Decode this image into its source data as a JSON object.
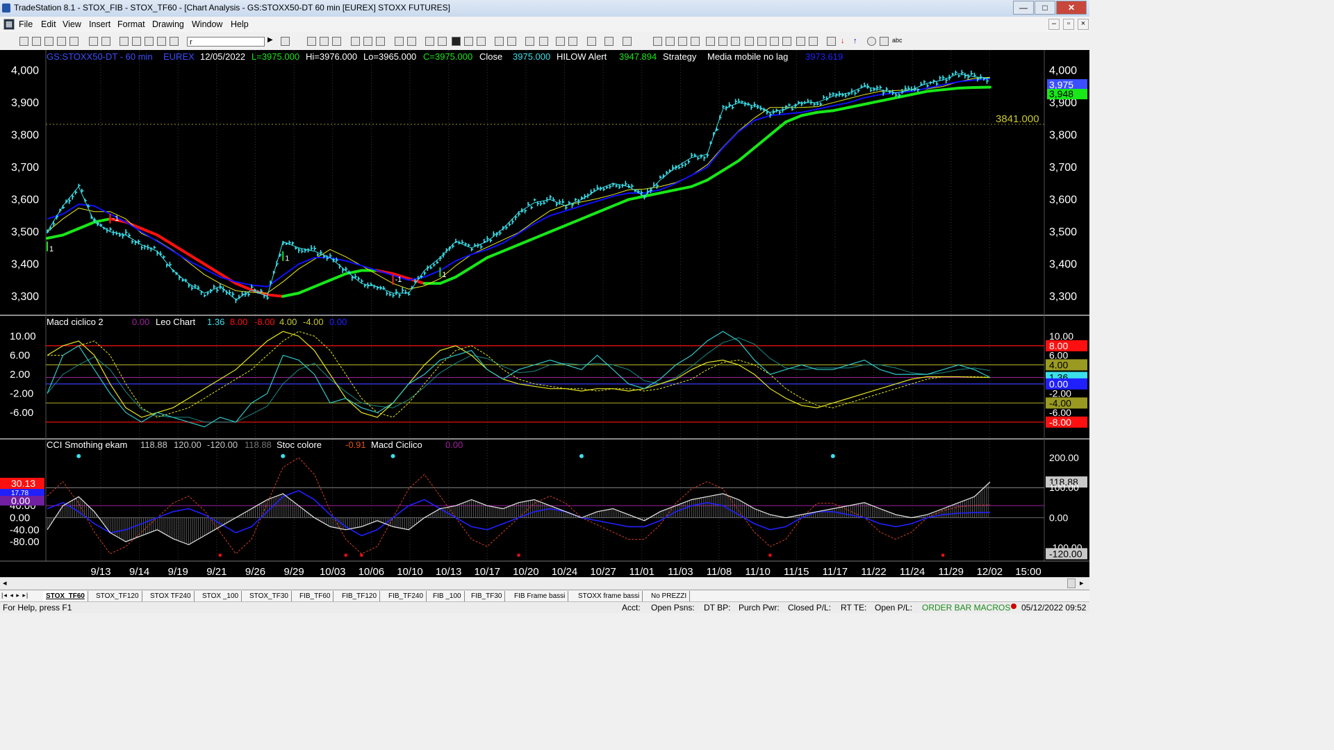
{
  "window": {
    "title": "TradeStation 8.1 - STOX_FIB - STOX_TF60 - [Chart Analysis - GS:STOXX50-DT  60 min  [EUREX] STOXX FUTURES]"
  },
  "menu": [
    "File",
    "Edit",
    "View",
    "Insert",
    "Format",
    "Drawing",
    "Window",
    "Help"
  ],
  "toolbar": {
    "symbol_value": "r"
  },
  "header": {
    "symbol": "GS:STOXX50-DT - 60 min",
    "exchange": "EUREX",
    "date": "12/05/2022",
    "last": "L=3975.000",
    "high": "Hi=3976.000",
    "low": "Lo=3965.000",
    "close": "C=3975.000",
    "close_label": "Close",
    "close_value": "3975.000",
    "hilow_label": "HILOW Alert",
    "hilow_value": "3947.894",
    "strategy_label": "Strategy",
    "media_label": "Media mobile no lag",
    "media_value": "3973.619"
  },
  "macd_header": {
    "name": "Macd ciclico 2",
    "v1": "0.00",
    "leo": "Leo Chart",
    "v2": "1.36",
    "v3": "8.00",
    "v4": "-8.00",
    "v5": "4.00",
    "v6": "-4.00",
    "v7": "0.00"
  },
  "cci_header": {
    "name": "CCI Smothing ekam",
    "v1": "118.88",
    "v2": "120.00",
    "v3": "-120.00",
    "v4": "118.88",
    "stoc": "Stoc colore",
    "stoc_val": "-0.91",
    "macd": "Macd Ciclico",
    "macd_val": "0.00"
  },
  "colors": {
    "price": "#3be0ea",
    "blue": "#1010ff",
    "green": "#18e818",
    "red": "#ff1010",
    "yellow": "#e8e820",
    "bg": "#000000"
  },
  "price_axis": {
    "ticks": [
      "4,000",
      "3,900",
      "3,800",
      "3,700",
      "3,600",
      "3,500",
      "3,400",
      "3,300"
    ]
  },
  "price_right_labels": {
    "last": "3,975",
    "hilow": "3,948",
    "line_value": "3841.000"
  },
  "macd_axis": {
    "ticks": [
      "10.00",
      "6.00",
      "2.00",
      "-2.00",
      "-6.00"
    ]
  },
  "macd_right_labels": {
    "red_top": "8.00",
    "tick6": "6.00",
    "yellow_top": "4.00",
    "current": "1.36",
    "zero": "0.00",
    "tick_m2": "-2.00",
    "yellow_bot": "-4.00",
    "tick_m6": "-6.00",
    "red_bot": "-8.00"
  },
  "cci_axis": {
    "ticks": [
      "80.00",
      "40.00",
      "0.00",
      "-40.00",
      "-80.00"
    ]
  },
  "cci_left_labels": {
    "red": "30.13",
    "blue": "17.78",
    "purple": "0.00"
  },
  "cci_right_labels": {
    "top": "200.00",
    "current": "118.88",
    "mid": "100.00",
    "zero": "0.00",
    "low": "-100.00",
    "bottom": "-120.00"
  },
  "date_axis": [
    "9/13",
    "9/14",
    "9/19",
    "9/21",
    "9/26",
    "9/29",
    "10/03",
    "10/06",
    "10/10",
    "10/13",
    "10/17",
    "10/20",
    "10/24",
    "10/27",
    "11/01",
    "11/03",
    "11/08",
    "11/10",
    "11/15",
    "11/17",
    "11/22",
    "11/24",
    "11/29",
    "12/02",
    "15:00"
  ],
  "signals": [
    "1",
    "-1",
    "1",
    "-1",
    "1"
  ],
  "tabs": [
    "STOX_TF60",
    "STOX_TF120",
    "STOX TF240",
    "STOX _100",
    "STOX_TF30",
    "FIB_TF60",
    "FIB_TF120",
    "FIB_TF240",
    "FIB _100",
    "FIB_TF30",
    "FIB Frame bassi",
    "STOXX frame bassi",
    "No PREZZI"
  ],
  "status": {
    "help": "For Help, press F1",
    "acct": "Acct:",
    "open_psns": "Open Psns:",
    "dt_bp": "DT BP:",
    "purch_pwr": "Purch Pwr:",
    "closed_pl": "Closed P/L:",
    "rt_te": "RT TE:",
    "open_pl": "Open P/L:",
    "macros": "ORDER BAR  MACROS",
    "datetime": "05/12/2022 09:52"
  },
  "chart_data": [
    {
      "type": "line",
      "title": "GS:STOXX50-DT - 60 min",
      "x": [
        "9/12",
        "9/13",
        "9/14",
        "9/15",
        "9/16",
        "9/19",
        "9/20",
        "9/21",
        "9/22",
        "9/23",
        "9/26",
        "9/27",
        "9/28",
        "9/29",
        "9/30",
        "10/03",
        "10/04",
        "10/05",
        "10/06",
        "10/07",
        "10/10",
        "10/11",
        "10/12",
        "10/13",
        "10/14",
        "10/17",
        "10/18",
        "10/19",
        "10/20",
        "10/21",
        "10/24",
        "10/25",
        "10/26",
        "10/27",
        "10/28",
        "10/31",
        "11/01",
        "11/02",
        "11/03",
        "11/04",
        "11/07",
        "11/08",
        "11/09",
        "11/10",
        "11/11",
        "11/14",
        "11/15",
        "11/16",
        "11/17",
        "11/18",
        "11/21",
        "11/22",
        "11/23",
        "11/24",
        "11/25",
        "11/28",
        "11/29",
        "11/30",
        "12/01",
        "12/02",
        "12/05"
      ],
      "series": [
        {
          "values": [
            3500,
            3580,
            3640,
            3530,
            3500,
            3490,
            3460,
            3440,
            3380,
            3340,
            3310,
            3330,
            3290,
            3320,
            3300,
            3470,
            3450,
            3440,
            3420,
            3380,
            3340,
            3330,
            3310,
            3310,
            3380,
            3420,
            3470,
            3450,
            3470,
            3510,
            3560,
            3590,
            3600,
            3580,
            3600,
            3630,
            3650,
            3640,
            3610,
            3660,
            3700,
            3730,
            3740,
            3880,
            3900,
            3890,
            3870,
            3880,
            3900,
            3900,
            3920,
            3930,
            3950,
            3940,
            3930,
            3940,
            3960,
            3970,
            3990,
            3980,
            3975
          ]
        },
        {
          "values": [
            3540,
            3555,
            3585,
            3580,
            3555,
            3530,
            3500,
            3470,
            3440,
            3410,
            3385,
            3360,
            3345,
            3335,
            3330,
            3365,
            3400,
            3420,
            3420,
            3410,
            3395,
            3380,
            3365,
            3350,
            3360,
            3380,
            3410,
            3430,
            3445,
            3465,
            3495,
            3525,
            3550,
            3565,
            3580,
            3595,
            3610,
            3620,
            3620,
            3630,
            3650,
            3675,
            3700,
            3760,
            3810,
            3845,
            3860,
            3865,
            3870,
            3880,
            3890,
            3900,
            3915,
            3925,
            3930,
            3935,
            3945,
            3955,
            3965,
            3970,
            3974
          ]
        },
        {
          "values": [
            3480,
            3490,
            3510,
            3530,
            3540,
            3530,
            3510,
            3490,
            3460,
            3430,
            3400,
            3370,
            3340,
            3320,
            3305,
            3300,
            3310,
            3330,
            3350,
            3370,
            3380,
            3380,
            3370,
            3355,
            3340,
            3340,
            3360,
            3390,
            3420,
            3440,
            3460,
            3480,
            3500,
            3520,
            3540,
            3560,
            3580,
            3600,
            3610,
            3620,
            3630,
            3640,
            3660,
            3690,
            3720,
            3760,
            3800,
            3840,
            3860,
            3870,
            3875,
            3885,
            3895,
            3905,
            3915,
            3925,
            3935,
            3940,
            3945,
            3947,
            3948
          ]
        }
      ],
      "ylim": [
        3250,
        4020
      ],
      "price_line": 3841
    },
    {
      "type": "line",
      "title": "Macd ciclico 2",
      "ylim": [
        -10.5,
        12.2
      ],
      "levels": [
        8,
        4,
        0,
        -4,
        -8
      ],
      "series": [
        {
          "values": [
            -2,
            6,
            8,
            3,
            -2,
            -6,
            -8,
            -6,
            -7,
            -8,
            -9,
            -7,
            -8,
            -4,
            -2,
            6,
            5,
            2,
            -4,
            -3,
            -5,
            -6,
            -4,
            0,
            2,
            5,
            6,
            7,
            3,
            1,
            3,
            4,
            5,
            4,
            3,
            6,
            3,
            0,
            -1,
            1,
            4,
            6,
            9,
            11,
            9,
            5,
            2,
            3,
            4,
            3,
            3,
            4,
            5,
            3,
            2,
            2,
            2,
            3,
            4,
            3,
            1.36
          ]
        },
        {
          "values": [
            6,
            8,
            9,
            6,
            0,
            -5,
            -7,
            -6,
            -5,
            -3,
            -1,
            1,
            3,
            6,
            9,
            11,
            10,
            7,
            2,
            -3,
            -6,
            -7,
            -4,
            0,
            4,
            7,
            8,
            6,
            3,
            1,
            0,
            -0.5,
            -1,
            -1,
            -1.5,
            -1,
            -1,
            -1.5,
            -1,
            0,
            1,
            3,
            4.5,
            5,
            4,
            2,
            -1,
            -3,
            -4.5,
            -5,
            -4,
            -3,
            -2,
            -1,
            0,
            1,
            1.5,
            1.5,
            1.5,
            1.4,
            1.36
          ]
        }
      ]
    },
    {
      "type": "line",
      "title": "CCI Smothing ekam",
      "ylim": [
        -140,
        230
      ],
      "levels": [
        200,
        100,
        0,
        -100
      ],
      "series": [
        {
          "values": [
            -40,
            40,
            70,
            20,
            -50,
            -80,
            -60,
            -40,
            -70,
            -90,
            -60,
            -30,
            0,
            30,
            60,
            80,
            40,
            0,
            -30,
            -40,
            -30,
            -10,
            -30,
            -40,
            0,
            30,
            40,
            60,
            40,
            30,
            50,
            60,
            40,
            20,
            0,
            20,
            30,
            10,
            -10,
            20,
            40,
            60,
            70,
            80,
            60,
            30,
            10,
            0,
            10,
            20,
            30,
            40,
            50,
            30,
            10,
            0,
            10,
            30,
            50,
            70,
            119
          ]
        },
        {
          "values": [
            30,
            50,
            20,
            -20,
            -50,
            -40,
            -20,
            0,
            20,
            30,
            10,
            -20,
            -50,
            -30,
            20,
            70,
            90,
            60,
            10,
            -30,
            -60,
            -40,
            0,
            40,
            60,
            30,
            0,
            -30,
            -40,
            -20,
            0,
            20,
            30,
            20,
            0,
            -10,
            -20,
            -30,
            -30,
            -10,
            20,
            40,
            50,
            40,
            10,
            -20,
            -40,
            -30,
            0,
            20,
            20,
            10,
            0,
            -20,
            -30,
            -20,
            0,
            10,
            15,
            17,
            17.78
          ]
        }
      ]
    }
  ]
}
